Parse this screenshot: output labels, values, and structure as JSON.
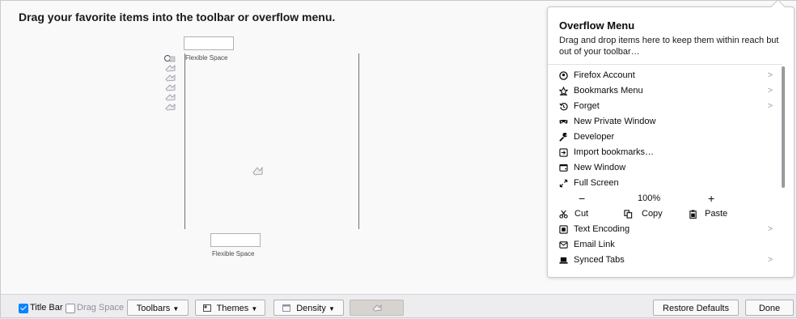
{
  "heading": "Drag your favorite items into the toolbar or overflow menu.",
  "palette": {
    "flexible_top": "Flexible Space",
    "flexible_bottom": "Flexible Space"
  },
  "overflow": {
    "title": "Overflow Menu",
    "description": "Drag and drop items here to keep them within reach but out of your toolbar…",
    "items": [
      {
        "label": "Firefox Account",
        "icon": "account-icon",
        "submenu": true
      },
      {
        "label": "Bookmarks Menu",
        "icon": "bookmarks-icon",
        "submenu": true
      },
      {
        "label": "Forget",
        "icon": "forget-icon",
        "submenu": true
      },
      {
        "label": "New Private Window",
        "icon": "private-window-icon",
        "submenu": false
      },
      {
        "label": "Developer",
        "icon": "wrench-icon",
        "submenu": false
      },
      {
        "label": "Import bookmarks…",
        "icon": "import-icon",
        "submenu": false
      },
      {
        "label": "New Window",
        "icon": "new-window-icon",
        "submenu": false
      },
      {
        "label": "Full Screen",
        "icon": "fullscreen-icon",
        "submenu": false
      }
    ],
    "zoom": {
      "minus": "−",
      "value": "100%",
      "plus": "+"
    },
    "edit": {
      "cut": "Cut",
      "copy": "Copy",
      "paste": "Paste"
    },
    "items2": [
      {
        "label": "Text Encoding",
        "icon": "text-encoding-icon",
        "submenu": true
      },
      {
        "label": "Email Link",
        "icon": "email-icon",
        "submenu": false
      },
      {
        "label": "Synced Tabs",
        "icon": "synced-tabs-icon",
        "submenu": true
      }
    ],
    "chevron": ">"
  },
  "bottom": {
    "title_bar": "Title Bar",
    "title_bar_checked": true,
    "drag_space": "Drag Space",
    "drag_space_checked": false,
    "toolbars": "Toolbars",
    "themes": "Themes",
    "density": "Density",
    "restore": "Restore Defaults",
    "done": "Done"
  }
}
